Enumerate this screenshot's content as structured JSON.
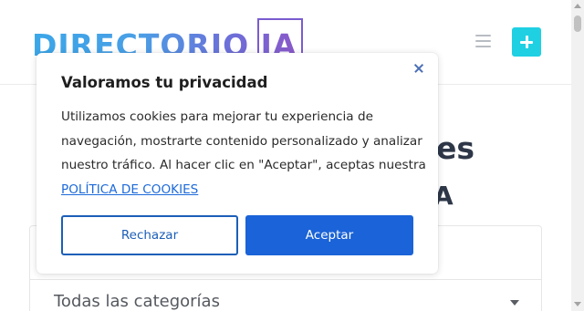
{
  "header": {
    "logo_text": "DIRECTORIO IA",
    "menu_icon": "hamburger-menu-icon",
    "add_icon": "plus-icon",
    "add_button_color": "#1fd0e3"
  },
  "hero": {
    "line1_fragment": "es",
    "line2_fragment": "A"
  },
  "filters": {
    "category_value": "Todas las categorías"
  },
  "cookie_dialog": {
    "title": "Valoramos tu privacidad",
    "body_text": "Utilizamos cookies para mejorar tu experiencia de navegación, mostrarte contenido personalizado y analizar nuestro tráfico. Al hacer clic en \"Aceptar\", aceptas nuestra",
    "policy_link": "POLÍTICA DE COOKIES",
    "reject_label": "Rechazar",
    "accept_label": "Aceptar",
    "accent_color": "#1a63d8"
  }
}
